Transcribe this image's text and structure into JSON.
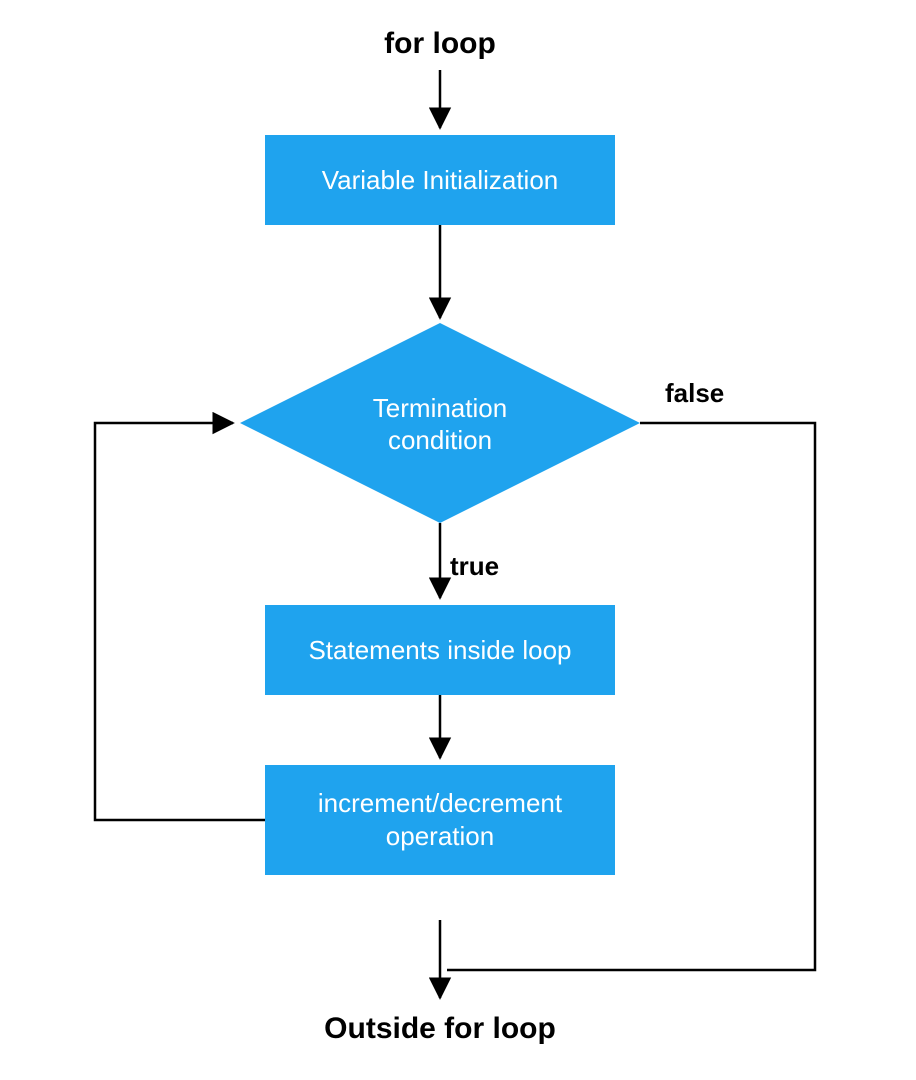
{
  "diagram": {
    "title": "for loop",
    "nodes": {
      "init": "Variable Initialization",
      "cond_line1": "Termination",
      "cond_line2": "condition",
      "body": "Statements inside loop",
      "incr_line1": "increment/decrement",
      "incr_line2": "operation",
      "exit": "Outside for loop"
    },
    "edges": {
      "true_label": "true",
      "false_label": "false"
    },
    "colors": {
      "box_fill": "#1fa3ee",
      "box_text": "#ffffff",
      "label_text": "#000000"
    }
  }
}
